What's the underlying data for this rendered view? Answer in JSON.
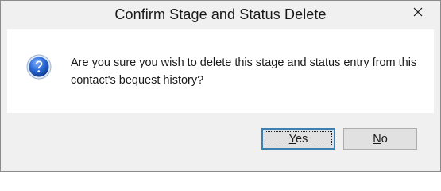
{
  "dialog": {
    "title": "Confirm Stage and Status Delete",
    "close_icon": "close-icon",
    "icon": "question-icon",
    "message": "Are you sure you wish to delete this stage and status entry from this contact's bequest history?",
    "buttons": {
      "yes": {
        "accel": "Y",
        "rest": "es"
      },
      "no": {
        "accel": "N",
        "rest": "o"
      }
    }
  },
  "colors": {
    "title_bar": "#f0f0f0",
    "content_bg": "#ffffff",
    "footer_bg": "#f0f0f0",
    "button_bg": "#e1e1e1",
    "default_button_border": "#3c7fb1",
    "icon_blue": "#1f5fbf"
  }
}
